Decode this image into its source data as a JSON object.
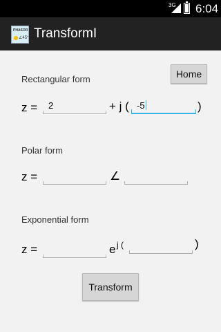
{
  "status_bar": {
    "network": "3G",
    "time": "6:04",
    "battery_level": 0.85
  },
  "app": {
    "title": "TransformI",
    "icon": "app-logo-icon"
  },
  "toolbar": {
    "home_label": "Home"
  },
  "rectangular": {
    "label": "Rectangular form",
    "z_label": "z =",
    "real_value": "2",
    "plus_j": "+ j (",
    "imag_value": "-5",
    "close_paren": ")"
  },
  "polar": {
    "label": "Polar form",
    "z_label": "z =",
    "magnitude_value": "",
    "angle_symbol": "∠",
    "angle_value": ""
  },
  "exponential": {
    "label": "Exponential form",
    "z_label": "z =",
    "magnitude_value": "",
    "e_symbol": "e",
    "j_paren": "j (",
    "exponent_value": "",
    "close_paren": ")"
  },
  "actions": {
    "transform_label": "Transform"
  },
  "colors": {
    "focus_accent": "#33b5e5",
    "action_bar": "#222222",
    "background": "#f2f2f2"
  }
}
